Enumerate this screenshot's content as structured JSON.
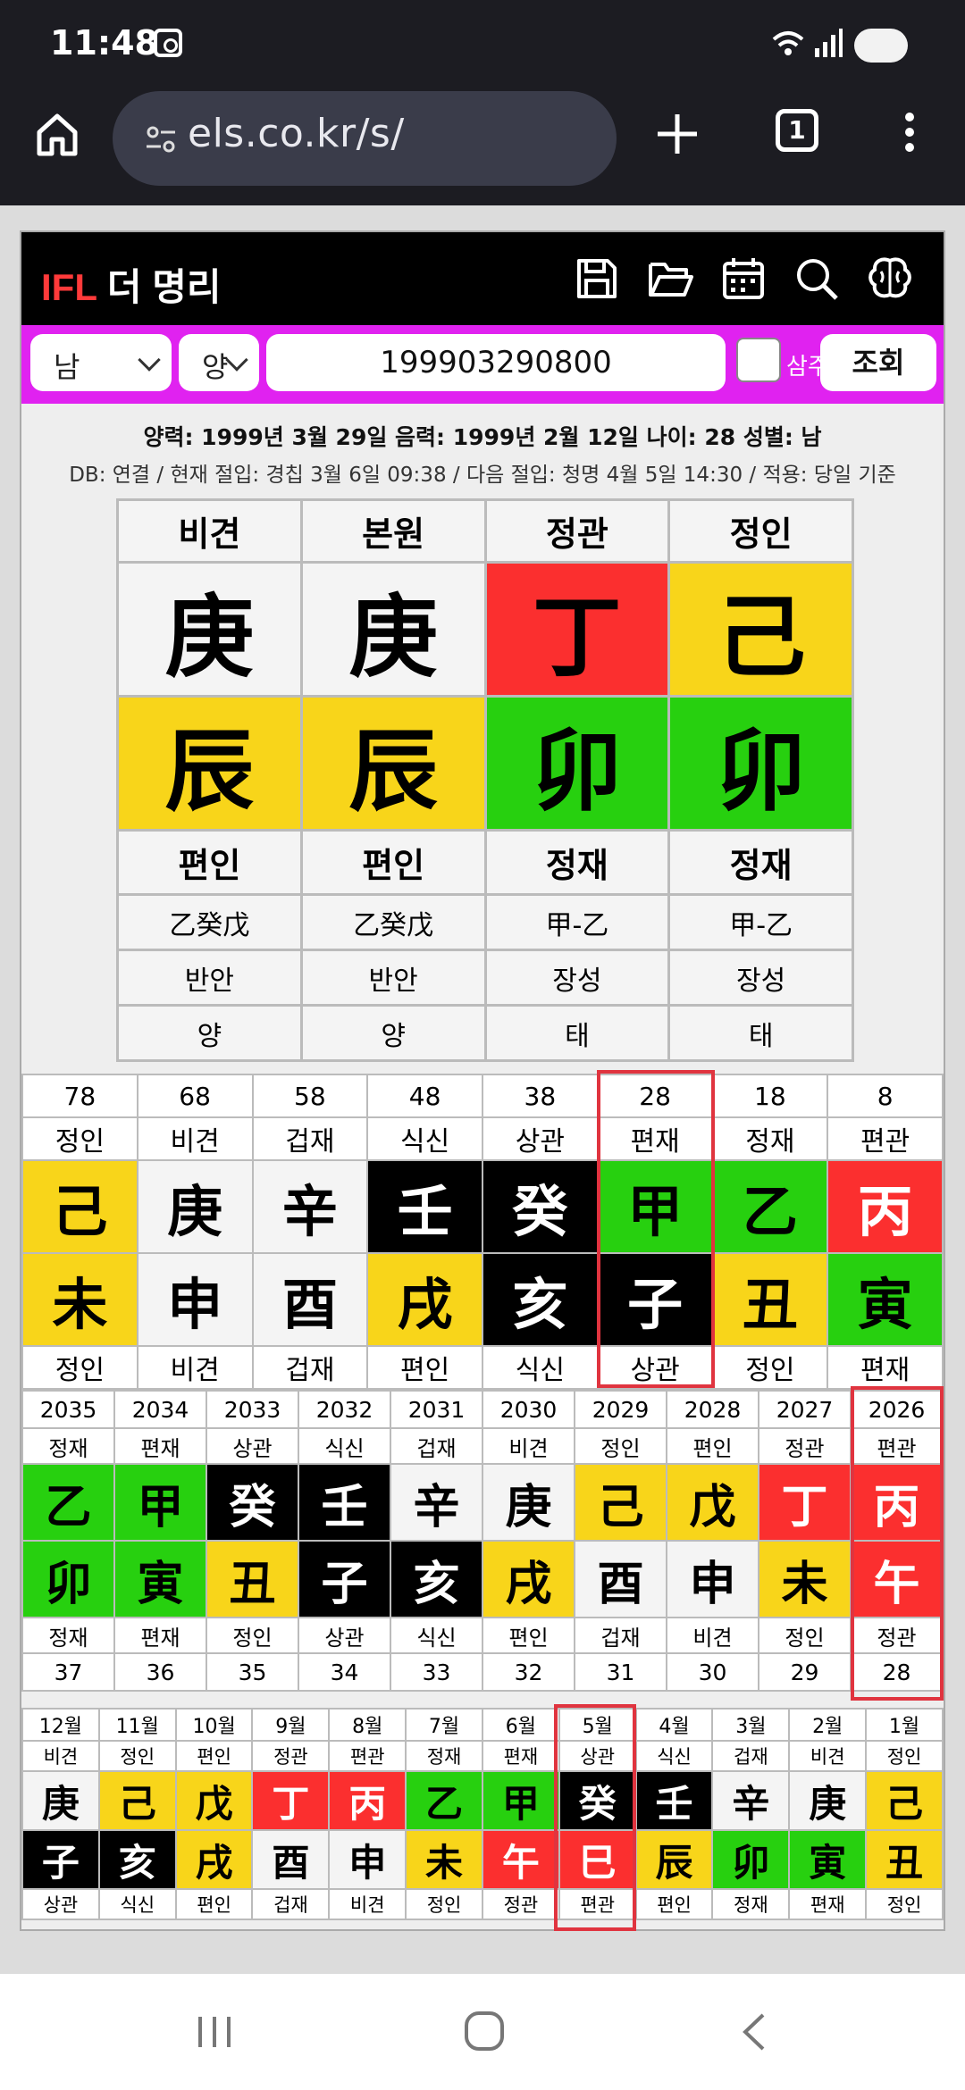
{
  "status": {
    "time": "11:48"
  },
  "browser": {
    "url": "els.co.kr/s/",
    "tab_count": "1"
  },
  "app": {
    "logo_ifl": "IFL",
    "logo_rest": " 더 명리",
    "controls": {
      "gender": "남",
      "calendar": "양",
      "birth_value": "199903290800",
      "lunar_label": "삼주",
      "query_label": "조회"
    },
    "info_line1": "양력: 1999년 3월 29일 음력: 1999년 2월 12일 나이: 28 성별: 남",
    "info_line2": "DB: 연결 / 현재 절입: 경칩 3월 6일 09:38 / 다음 절입: 청명 4월 5일 14:30 / 적용: 당일 기준",
    "pillars": [
      {
        "top": "비견",
        "stem": "庚",
        "branch": "辰",
        "tg2": "편인",
        "hidden": "乙癸戊",
        "stage": "반안",
        "extra": "양"
      },
      {
        "top": "본원",
        "stem": "庚",
        "branch": "辰",
        "tg2": "편인",
        "hidden": "乙癸戊",
        "stage": "반안",
        "extra": "양"
      },
      {
        "top": "정관",
        "stem": "丁",
        "branch": "卯",
        "tg2": "정재",
        "hidden": "甲-乙",
        "stage": "장성",
        "extra": "태"
      },
      {
        "top": "정인",
        "stem": "己",
        "branch": "卯",
        "tg2": "정재",
        "hidden": "甲-乙",
        "stage": "장성",
        "extra": "태"
      }
    ],
    "daeun": [
      {
        "n": "78",
        "t1": "정인",
        "s": "己",
        "b": "未",
        "t2": "정인"
      },
      {
        "n": "68",
        "t1": "비견",
        "s": "庚",
        "b": "申",
        "t2": "비견"
      },
      {
        "n": "58",
        "t1": "겁재",
        "s": "辛",
        "b": "酉",
        "t2": "겁재"
      },
      {
        "n": "48",
        "t1": "식신",
        "s": "壬",
        "b": "戌",
        "t2": "편인"
      },
      {
        "n": "38",
        "t1": "상관",
        "s": "癸",
        "b": "亥",
        "t2": "식신"
      },
      {
        "n": "28",
        "t1": "편재",
        "s": "甲",
        "b": "子",
        "t2": "상관"
      },
      {
        "n": "18",
        "t1": "정재",
        "s": "乙",
        "b": "丑",
        "t2": "정인"
      },
      {
        "n": "8",
        "t1": "편관",
        "s": "丙",
        "b": "寅",
        "t2": "편재"
      }
    ],
    "seun": [
      {
        "y": "2035",
        "t1": "정재",
        "s": "乙",
        "b": "卯",
        "t2": "정재",
        "a": "37"
      },
      {
        "y": "2034",
        "t1": "편재",
        "s": "甲",
        "b": "寅",
        "t2": "편재",
        "a": "36"
      },
      {
        "y": "2033",
        "t1": "상관",
        "s": "癸",
        "b": "丑",
        "t2": "정인",
        "a": "35"
      },
      {
        "y": "2032",
        "t1": "식신",
        "s": "壬",
        "b": "子",
        "t2": "상관",
        "a": "34"
      },
      {
        "y": "2031",
        "t1": "겁재",
        "s": "辛",
        "b": "亥",
        "t2": "식신",
        "a": "33"
      },
      {
        "y": "2030",
        "t1": "비견",
        "s": "庚",
        "b": "戌",
        "t2": "편인",
        "a": "32"
      },
      {
        "y": "2029",
        "t1": "정인",
        "s": "己",
        "b": "酉",
        "t2": "겁재",
        "a": "31"
      },
      {
        "y": "2028",
        "t1": "편인",
        "s": "戊",
        "b": "申",
        "t2": "비견",
        "a": "30"
      },
      {
        "y": "2027",
        "t1": "정관",
        "s": "丁",
        "b": "未",
        "t2": "정인",
        "a": "29"
      },
      {
        "y": "2026",
        "t1": "편관",
        "s": "丙",
        "b": "午",
        "t2": "정관",
        "a": "28"
      }
    ],
    "wolun": [
      {
        "m": "12월",
        "t1": "비견",
        "s": "庚",
        "b": "子",
        "t2": "상관"
      },
      {
        "m": "11월",
        "t1": "정인",
        "s": "己",
        "b": "亥",
        "t2": "식신"
      },
      {
        "m": "10월",
        "t1": "편인",
        "s": "戊",
        "b": "戌",
        "t2": "편인"
      },
      {
        "m": "9월",
        "t1": "정관",
        "s": "丁",
        "b": "酉",
        "t2": "겁재"
      },
      {
        "m": "8월",
        "t1": "편관",
        "s": "丙",
        "b": "申",
        "t2": "비견"
      },
      {
        "m": "7월",
        "t1": "정재",
        "s": "乙",
        "b": "未",
        "t2": "정인"
      },
      {
        "m": "6월",
        "t1": "편재",
        "s": "甲",
        "b": "午",
        "t2": "정관"
      },
      {
        "m": "5월",
        "t1": "상관",
        "s": "癸",
        "b": "巳",
        "t2": "편관"
      },
      {
        "m": "4월",
        "t1": "식신",
        "s": "壬",
        "b": "辰",
        "t2": "편인"
      },
      {
        "m": "3월",
        "t1": "겁재",
        "s": "辛",
        "b": "卯",
        "t2": "정재"
      },
      {
        "m": "2월",
        "t1": "비견",
        "s": "庚",
        "b": "寅",
        "t2": "편재"
      },
      {
        "m": "1월",
        "t1": "정인",
        "s": "己",
        "b": "丑",
        "t2": "정인"
      }
    ]
  },
  "element_colors": {
    "wood": "#27d00f",
    "fire": "#fb2f2f",
    "earth": "#f8d51a",
    "metal": "#f4f4f4",
    "water": "#000000"
  },
  "highlight_color": "#e0343f",
  "brand_color": "#e022f0",
  "icons": [
    "save-icon",
    "folder-open-icon",
    "calendar-icon",
    "search-icon",
    "brain-icon",
    "home-icon",
    "plus-icon",
    "menu-icon"
  ]
}
